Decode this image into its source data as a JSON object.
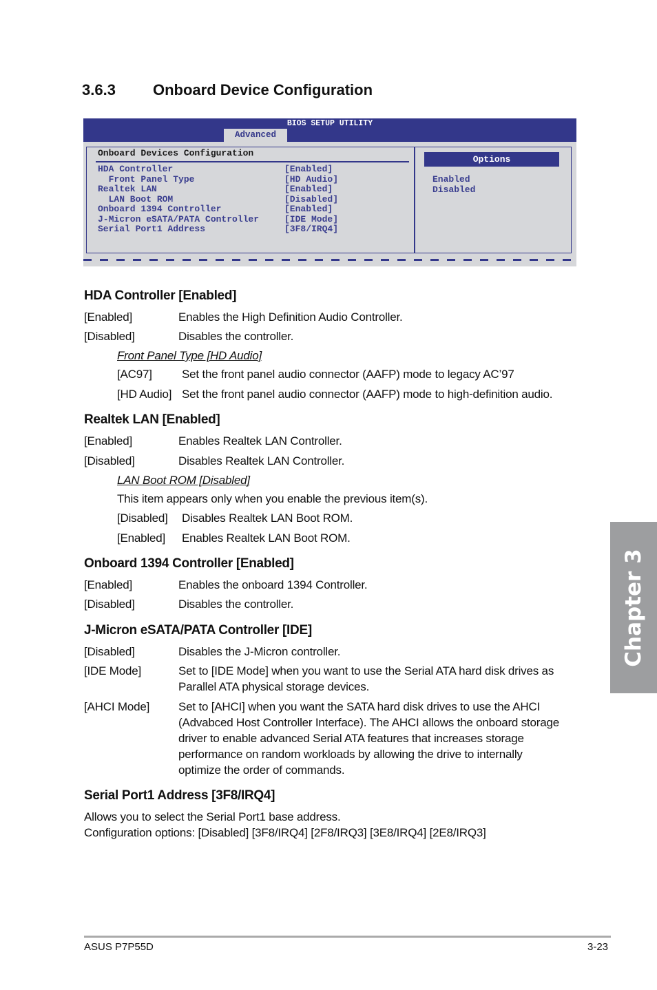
{
  "section": {
    "number": "3.6.3",
    "title": "Onboard Device Configuration"
  },
  "bios": {
    "utility_title": "BIOS SETUP UTILITY",
    "active_tab": "Advanced",
    "panel_title": "Onboard Devices Configuration",
    "items": [
      {
        "label": "HDA Controller",
        "value": "[Enabled]",
        "indent": false
      },
      {
        "label": "  Front Panel Type",
        "value": "[HD Audio]",
        "indent": true
      },
      {
        "label": "Realtek LAN",
        "value": "[Enabled]",
        "indent": false
      },
      {
        "label": "  LAN Boot ROM",
        "value": "[Disabled]",
        "indent": true
      },
      {
        "label": "Onboard 1394 Controller",
        "value": "[Enabled]",
        "indent": false
      },
      {
        "label": "J-Micron eSATA/PATA Controller",
        "value": "[IDE Mode]",
        "indent": false
      },
      {
        "label": "Serial Port1 Address",
        "value": "[3F8/IRQ4]",
        "indent": false
      }
    ],
    "options_title": "Options",
    "options": [
      "Enabled",
      "Disabled"
    ],
    "colors": {
      "bar": "#33378a",
      "panel_bg": "#d6d7da",
      "item_text": "#3a3e8f"
    }
  },
  "hda": {
    "heading": "HDA Controller [Enabled]",
    "rows": [
      {
        "key": "[Enabled]",
        "desc": "Enables the High Definition Audio Controller."
      },
      {
        "key": "[Disabled]",
        "desc": "Disables the controller."
      }
    ],
    "sub_heading": "Front Panel Type [HD Audio]",
    "sub_rows": [
      {
        "key": "[AC97]",
        "desc": "Set the front panel audio connector (AAFP) mode to legacy AC’97"
      },
      {
        "key": "[HD Audio]",
        "desc": "Set the front panel audio connector (AAFP) mode to high-definition audio."
      }
    ]
  },
  "lan": {
    "heading": "Realtek LAN [Enabled]",
    "rows": [
      {
        "key": "[Enabled]",
        "desc": "Enables Realtek LAN Controller."
      },
      {
        "key": "[Disabled]",
        "desc": "Disables Realtek LAN Controller."
      }
    ],
    "sub_heading": "LAN Boot ROM [Disabled]",
    "sub_note": "This item appears only when you enable the previous item(s).",
    "sub_rows": [
      {
        "key": "[Disabled]",
        "desc": "Disables Realtek LAN Boot ROM."
      },
      {
        "key": "[Enabled]",
        "desc": "Enables Realtek LAN Boot ROM."
      }
    ]
  },
  "ieee1394": {
    "heading": "Onboard 1394 Controller [Enabled]",
    "rows": [
      {
        "key": "[Enabled]",
        "desc": "Enables the onboard 1394 Controller."
      },
      {
        "key": "[Disabled]",
        "desc": "Disables the controller."
      }
    ]
  },
  "jmicron": {
    "heading": "J-Micron eSATA/PATA Controller [IDE]",
    "rows": [
      {
        "key": "[Disabled]",
        "lines": [
          "Disables the J-Micron controller."
        ]
      },
      {
        "key": "[IDE Mode]",
        "lines": [
          "Set to [IDE Mode] when you want to use the Serial ATA hard disk drives as",
          "Parallel ATA physical storage devices."
        ]
      },
      {
        "key": "[AHCI Mode]",
        "lines": [
          "Set to [AHCI] when you want the SATA hard disk drives to use the AHCI",
          "(Advabced Host Controller Interface). The AHCI allows the onboard storage",
          "driver to enable advanced Serial ATA features that increases storage",
          "performance on random workloads by allowing the drive to internally",
          "optimize the order of commands."
        ]
      }
    ]
  },
  "serial": {
    "heading": "Serial Port1 Address [3F8/IRQ4]",
    "lines": [
      "Allows you to select the Serial Port1 base address.",
      "Configuration options: [Disabled] [3F8/IRQ4] [2F8/IRQ3] [3E8/IRQ4] [2E8/IRQ3]"
    ]
  },
  "chapter_tab": "Chapter 3",
  "footer": {
    "product": "ASUS P7P55D",
    "page": "3-23"
  }
}
